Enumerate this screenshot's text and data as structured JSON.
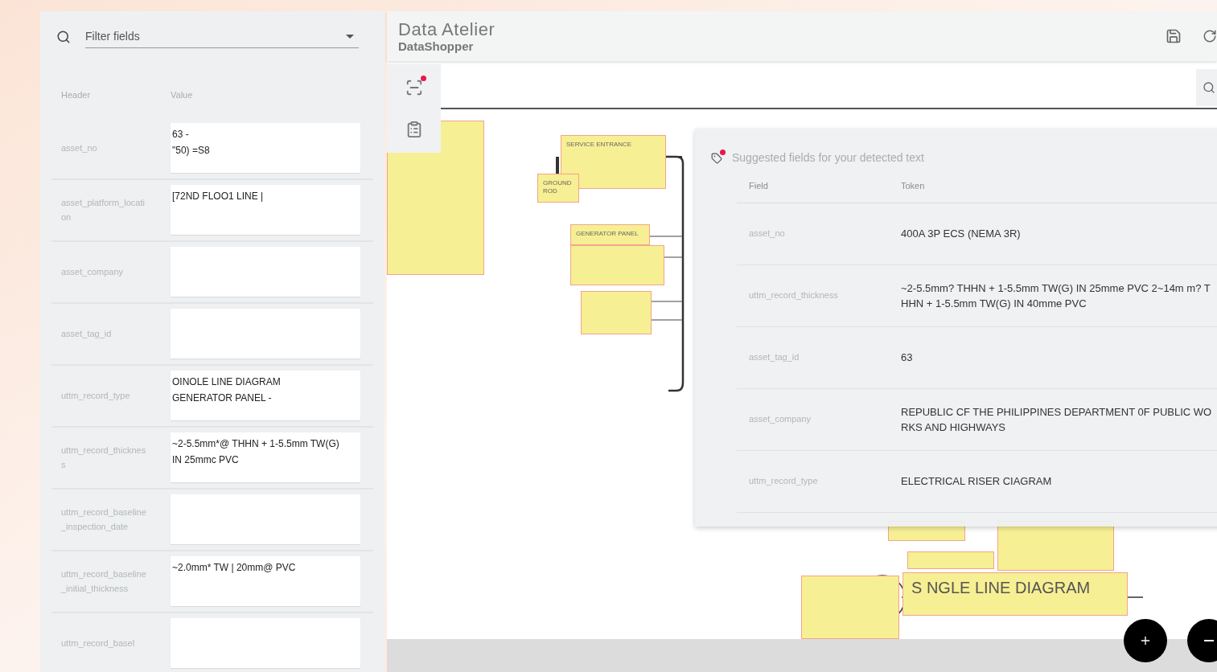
{
  "brand": {
    "title": "Data Atelier",
    "subtitle": "DataShopper"
  },
  "filter": {
    "placeholder": "Filter fields"
  },
  "field_table": {
    "columns": [
      "Header",
      "Value"
    ],
    "rows": [
      {
        "header": "asset_no",
        "value": "63 -\n\"50) =S8"
      },
      {
        "header": "asset_platform_location",
        "value": "[72ND FLOO1 LINE |"
      },
      {
        "header": "asset_company",
        "value": ""
      },
      {
        "header": "asset_tag_id",
        "value": ""
      },
      {
        "header": "uttm_record_type",
        "value": "OINOLE LINE DIAGRAM\nGENERATOR PANEL -"
      },
      {
        "header": "uttm_record_thickness",
        "value": "~2-5.5mm*@ THHN + 1-5.5mm TW(G)\nIN 25mmc PVC"
      },
      {
        "header": "uttm_record_baseline_inspection_date",
        "value": ""
      },
      {
        "header": "uttm_record_baseline_initial_thickness",
        "value": "~2.0mm* TW | 20mm@ PVC"
      },
      {
        "header": "uttm_record_basel",
        "value": ""
      }
    ]
  },
  "toolbar": [
    {
      "kind": "scan",
      "alert": true
    },
    {
      "kind": "clipboard",
      "alert": false
    }
  ],
  "drawing": {
    "labels": [
      {
        "text": "SERVICE ENTRANCE",
        "kind": "small"
      },
      {
        "text": "GROUND ROD",
        "kind": "small"
      },
      {
        "text": "GENERATOR PANEL",
        "kind": "small"
      },
      {
        "text": "S NGLE LINE DIAGRAM",
        "kind": "title"
      }
    ]
  },
  "suggestions": {
    "title": "Suggested fields for your detected text",
    "alert": true,
    "columns": [
      "Field",
      "Token"
    ],
    "rows": [
      {
        "field": "asset_no",
        "token": "400A 3P ECS (NEMA 3R)"
      },
      {
        "field": "uttm_record_thickness",
        "token": "~2-5.5mm? THHN + 1-5.5mm TW(G) IN 25mme PVC  2~14m m? THHN + 1-5.5mm TW(G) IN 40mme PVC"
      },
      {
        "field": "asset_tag_id",
        "token": "63"
      },
      {
        "field": "asset_company",
        "token": "REPUBLIC CF THE PHILIPPINES DEPARTMENT 0F PUBLIC WO RKS AND HIGHWAYS"
      },
      {
        "field": "uttm_record_type",
        "token": "ELECTRICAL RISER CIAGRAM"
      }
    ]
  }
}
